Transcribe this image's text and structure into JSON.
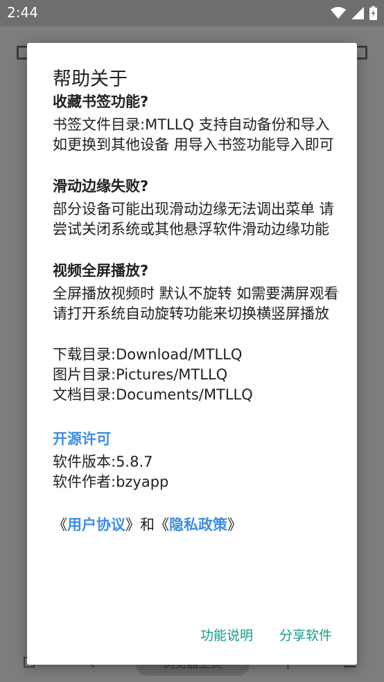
{
  "status_bar": {
    "time": "2:44"
  },
  "background": {
    "home_pill_label": "浏览器主页"
  },
  "dialog": {
    "title": "帮助关于",
    "sections": [
      {
        "heading": "收藏书签功能?",
        "text": "书签文件目录:MTLLQ 支持自动备份和导入 如更换到其他设备 用导入书签功能导入即可"
      },
      {
        "heading": "滑动边缘失败?",
        "text": "部分设备可能出现滑动边缘无法调出菜单 请尝试关闭系统或其他悬浮软件滑动边缘功能"
      },
      {
        "heading": "视频全屏播放?",
        "text": "全屏播放视频时 默认不旋转 如需要满屏观看 请打开系统自动旋转功能来切换横竖屏播放"
      }
    ],
    "directories": [
      "下载目录:Download/MTLLQ",
      "图片目录:Pictures/MTLLQ",
      "文档目录:Documents/MTLLQ"
    ],
    "open_source_link": "开源许可",
    "version": "软件版本:5.8.7",
    "author": "软件作者:bzyapp",
    "agreement": {
      "prefix": "《",
      "user_agreement": "用户协议",
      "middle": "》和《",
      "privacy_policy": "隐私政策",
      "suffix": "》"
    },
    "actions": {
      "feature_description": "功能说明",
      "share_app": "分享软件"
    }
  },
  "colors": {
    "accent_blue": "#3d8de0",
    "action_teal": "#149b8c",
    "text": "#212121"
  }
}
